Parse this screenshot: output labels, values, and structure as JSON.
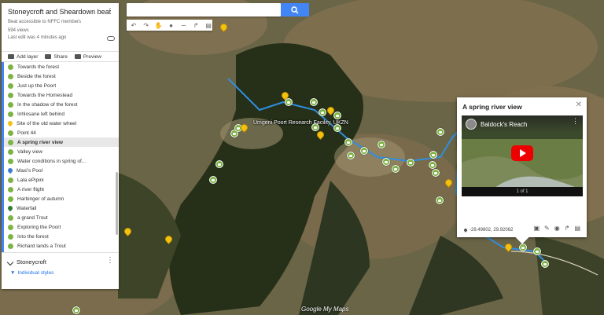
{
  "map": {
    "title": "Stoneycroft and Sheardown beat",
    "description": "Beat accessible to NFFC members",
    "views": "594 views",
    "last_edit": "Last edit was 4 minutes ago",
    "actions": {
      "add_layer": "Add layer",
      "share": "Share",
      "preview": "Preview"
    },
    "icons": {
      "menu": "kebab-icon",
      "cloud": "cloud-saved-icon"
    }
  },
  "layer_items": [
    {
      "label": "Towards the forest",
      "marker": "green"
    },
    {
      "label": "Beside the forest",
      "marker": "green"
    },
    {
      "label": "Just up the Poort",
      "marker": "green"
    },
    {
      "label": "Towards the Homestead",
      "marker": "green"
    },
    {
      "label": "In the shadow of the forest",
      "marker": "green"
    },
    {
      "label": "Inhlosane left behind",
      "marker": "green"
    },
    {
      "label": "Site of the old water wheel",
      "marker": "yellow"
    },
    {
      "label": "Point 44",
      "marker": "green"
    },
    {
      "label": "A spring river view",
      "marker": "green",
      "selected": true
    },
    {
      "label": "Valley view",
      "marker": "green"
    },
    {
      "label": "Water conditions in spring of...",
      "marker": "green"
    },
    {
      "label": "Maxi's Pool",
      "marker": "blue"
    },
    {
      "label": "Lala ePipini",
      "marker": "green"
    },
    {
      "label": "A river flight",
      "marker": "green"
    },
    {
      "label": "Harbinger of autumn",
      "marker": "green"
    },
    {
      "label": "Waterfall",
      "marker": "dark-green"
    },
    {
      "label": "a grand Trout",
      "marker": "green"
    },
    {
      "label": "Exploring the Poort",
      "marker": "green"
    },
    {
      "label": "Into the forest",
      "marker": "green"
    },
    {
      "label": "Richard lands a Trout",
      "marker": "green"
    }
  ],
  "second_layer": {
    "name": "Stoneycroft",
    "styles": "Individual styles"
  },
  "search": {
    "placeholder": ""
  },
  "popup": {
    "title": "A spring river view",
    "video_title": "Baldock's Reach",
    "pager": "1 of 1",
    "coords": "-29.49802, 29.92062",
    "close_icon": "close-icon",
    "play_color": "#ff0000"
  },
  "map_labels": {
    "facility": "Umgeni Poort Research Facility, UKZN"
  },
  "branding": "Google My Maps",
  "colors": {
    "accent": "#4285f4",
    "marker_green": "#7cb342",
    "marker_yellow": "#f4c20d",
    "route": "#2f8fe0"
  }
}
